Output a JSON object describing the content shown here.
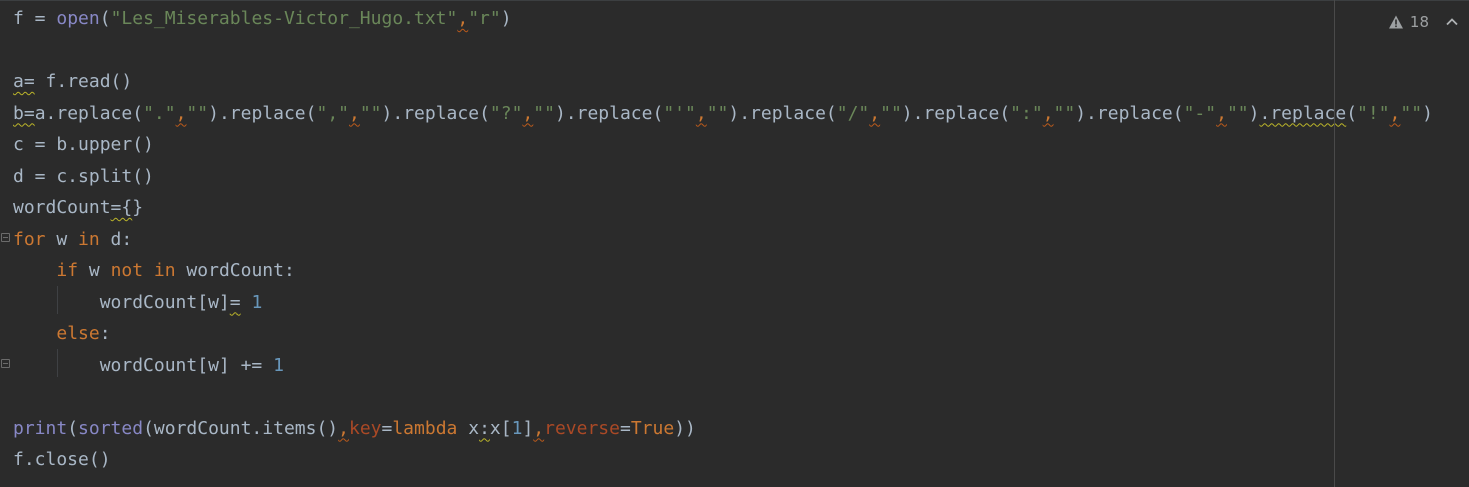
{
  "editor": {
    "inspection": {
      "warning_count": "18",
      "warning_icon": "warning-triangle-icon",
      "nav_icon": "chevron-up-icon"
    },
    "lines": [
      [
        [
          "plain",
          "f = "
        ],
        [
          "fn",
          "open"
        ],
        [
          "plain",
          "("
        ],
        [
          "str",
          "\"Les_Miserables-Victor_Hugo.txt\""
        ],
        [
          "puncw",
          ","
        ],
        [
          "str",
          "\"r\""
        ],
        [
          "plain",
          ")"
        ]
      ],
      [],
      [
        [
          "warn",
          "a="
        ],
        [
          "plain",
          " f.read()"
        ]
      ],
      [
        [
          "warn",
          "b="
        ],
        [
          "plain",
          "a.replace("
        ],
        [
          "str",
          "\".\""
        ],
        [
          "puncw",
          ","
        ],
        [
          "str",
          "\"\""
        ],
        [
          "plain",
          ").replace("
        ],
        [
          "str",
          "\",\""
        ],
        [
          "puncw",
          ","
        ],
        [
          "str",
          "\"\""
        ],
        [
          "plain",
          ").replace("
        ],
        [
          "str",
          "\"?\""
        ],
        [
          "puncw",
          ","
        ],
        [
          "str",
          "\"\""
        ],
        [
          "plain",
          ").replace("
        ],
        [
          "str",
          "\"'\""
        ],
        [
          "puncw",
          ","
        ],
        [
          "str",
          "\"\""
        ],
        [
          "plain",
          ").replace("
        ],
        [
          "str",
          "\"/\""
        ],
        [
          "puncw",
          ","
        ],
        [
          "str",
          "\"\""
        ],
        [
          "plain",
          ").replace("
        ],
        [
          "str",
          "\":\""
        ],
        [
          "puncw",
          ","
        ],
        [
          "str",
          "\"\""
        ],
        [
          "plain",
          ").replace("
        ],
        [
          "str",
          "\"-\""
        ],
        [
          "puncw",
          ","
        ],
        [
          "str",
          "\"\""
        ],
        [
          "plain",
          ")"
        ],
        [
          "warn",
          ".replace"
        ],
        [
          "plain",
          "("
        ],
        [
          "str",
          "\"!\""
        ],
        [
          "puncw",
          ","
        ],
        [
          "str",
          "\"\""
        ],
        [
          "plain",
          ")"
        ]
      ],
      [
        [
          "plain",
          "c = b.upper()"
        ]
      ],
      [
        [
          "plain",
          "d = c.split()"
        ]
      ],
      [
        [
          "plain",
          "wordCount"
        ],
        [
          "warn",
          "={"
        ],
        [
          "plain",
          "}"
        ]
      ],
      [
        [
          "kw",
          "for"
        ],
        [
          "plain",
          " w "
        ],
        [
          "kw",
          "in"
        ],
        [
          "plain",
          " d:"
        ]
      ],
      [
        [
          "plain",
          "    "
        ],
        [
          "kw",
          "if"
        ],
        [
          "plain",
          " w "
        ],
        [
          "kw",
          "not in"
        ],
        [
          "plain",
          " wordCount:"
        ]
      ],
      [
        [
          "plain",
          "        wordCount[w]"
        ],
        [
          "warn",
          "="
        ],
        [
          "plain",
          " "
        ],
        [
          "num",
          "1"
        ]
      ],
      [
        [
          "plain",
          "    "
        ],
        [
          "kw",
          "else"
        ],
        [
          "plain",
          ":"
        ]
      ],
      [
        [
          "plain",
          "        wordCount[w] += "
        ],
        [
          "num",
          "1"
        ]
      ],
      [],
      [
        [
          "fn",
          "print"
        ],
        [
          "plain",
          "("
        ],
        [
          "fn",
          "sorted"
        ],
        [
          "plain",
          "(wordCount.items()"
        ],
        [
          "puncw",
          ","
        ],
        [
          "param",
          "key"
        ],
        [
          "plain",
          "="
        ],
        [
          "kw",
          "lambda"
        ],
        [
          "plain",
          " x"
        ],
        [
          "warn",
          ":"
        ],
        [
          "plain",
          "x["
        ],
        [
          "num",
          "1"
        ],
        [
          "plain",
          "]"
        ],
        [
          "puncw",
          ","
        ],
        [
          "param",
          "reverse"
        ],
        [
          "plain",
          "="
        ],
        [
          "kw",
          "True"
        ],
        [
          "plain",
          "))"
        ]
      ],
      [
        [
          "plain",
          "f.close()"
        ]
      ]
    ]
  }
}
